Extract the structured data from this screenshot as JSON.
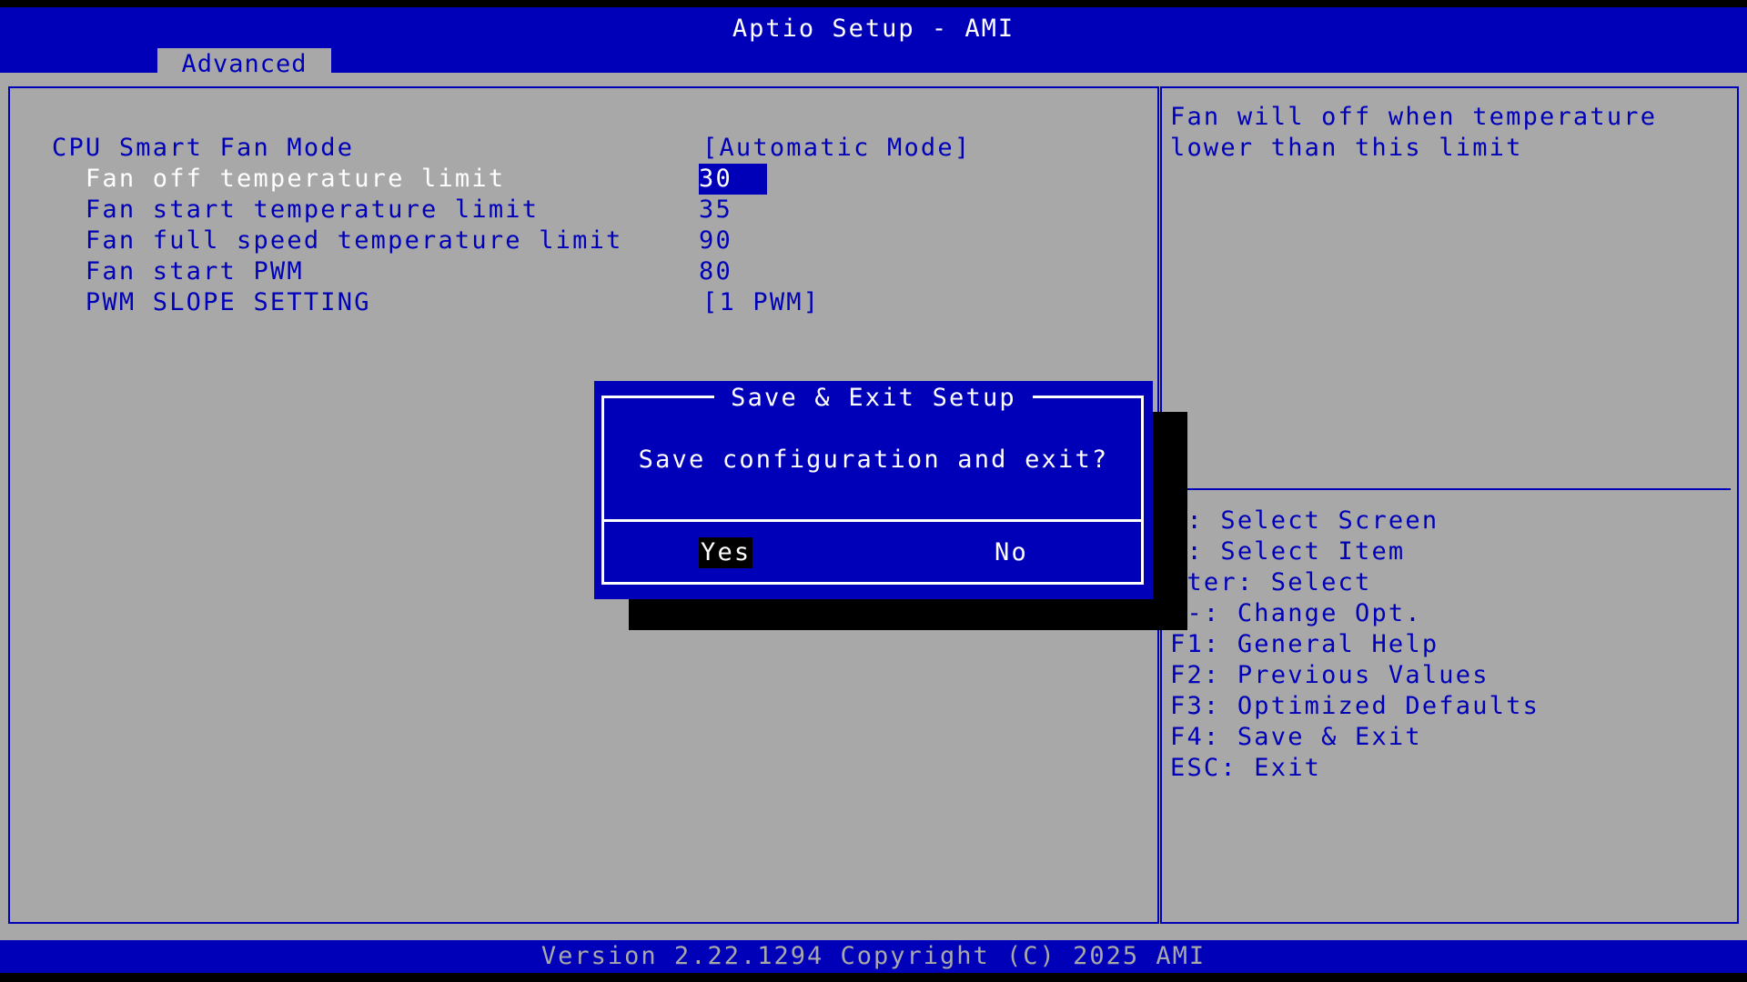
{
  "header": {
    "title": "Aptio Setup - AMI",
    "tabs": [
      {
        "label": "Advanced",
        "active": true
      }
    ]
  },
  "settings": [
    {
      "label": "CPU Smart Fan Mode",
      "value": "[Automatic Mode]"
    },
    {
      "label": "  Fan off temperature limit",
      "value": "30",
      "selected": true
    },
    {
      "label": "  Fan start temperature limit",
      "value": "35"
    },
    {
      "label": "  Fan full speed temperature limit",
      "value": "90"
    },
    {
      "label": "  Fan start PWM",
      "value": "80"
    },
    {
      "label": "  PWM SLOPE SETTING",
      "value": "[1 PWM]"
    }
  ],
  "help": {
    "line1": "Fan will off when temperature",
    "line2": "lower than this limit"
  },
  "keys": [
    "←: Select Screen",
    "↓: Select Item",
    "nter: Select",
    "/-: Change Opt.",
    "F1: General Help",
    "F2: Previous Values",
    "F3: Optimized Defaults",
    "F4: Save & Exit",
    "ESC: Exit"
  ],
  "dialog": {
    "title": "Save & Exit Setup",
    "message": "Save configuration and exit?",
    "yes_label": "Yes",
    "no_label": "No"
  },
  "footer": {
    "text": "Version 2.22.1294 Copyright (C) 2025 AMI"
  },
  "colors": {
    "bios_blue": "#0000b8",
    "bios_gray": "#a8a8a8",
    "text_white": "#ffffff",
    "shadow_black": "#000000"
  }
}
